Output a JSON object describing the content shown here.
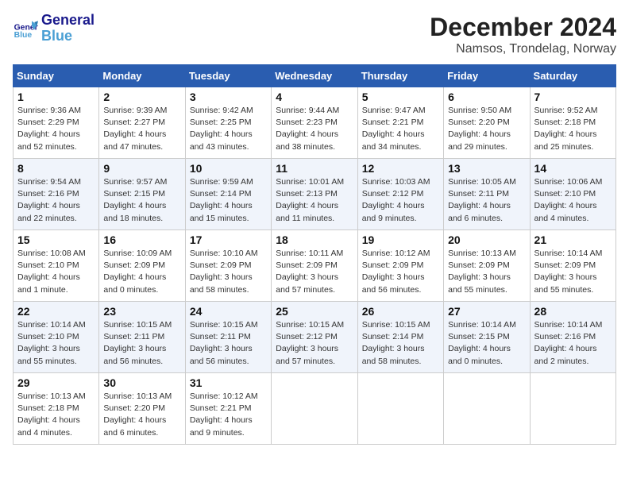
{
  "logo": {
    "general": "General",
    "blue": "Blue"
  },
  "title": "December 2024",
  "subtitle": "Namsos, Trondelag, Norway",
  "headers": [
    "Sunday",
    "Monday",
    "Tuesday",
    "Wednesday",
    "Thursday",
    "Friday",
    "Saturday"
  ],
  "weeks": [
    [
      {
        "day": "1",
        "sunrise": "Sunrise: 9:36 AM",
        "sunset": "Sunset: 2:29 PM",
        "daylight": "Daylight: 4 hours and 52 minutes."
      },
      {
        "day": "2",
        "sunrise": "Sunrise: 9:39 AM",
        "sunset": "Sunset: 2:27 PM",
        "daylight": "Daylight: 4 hours and 47 minutes."
      },
      {
        "day": "3",
        "sunrise": "Sunrise: 9:42 AM",
        "sunset": "Sunset: 2:25 PM",
        "daylight": "Daylight: 4 hours and 43 minutes."
      },
      {
        "day": "4",
        "sunrise": "Sunrise: 9:44 AM",
        "sunset": "Sunset: 2:23 PM",
        "daylight": "Daylight: 4 hours and 38 minutes."
      },
      {
        "day": "5",
        "sunrise": "Sunrise: 9:47 AM",
        "sunset": "Sunset: 2:21 PM",
        "daylight": "Daylight: 4 hours and 34 minutes."
      },
      {
        "day": "6",
        "sunrise": "Sunrise: 9:50 AM",
        "sunset": "Sunset: 2:20 PM",
        "daylight": "Daylight: 4 hours and 29 minutes."
      },
      {
        "day": "7",
        "sunrise": "Sunrise: 9:52 AM",
        "sunset": "Sunset: 2:18 PM",
        "daylight": "Daylight: 4 hours and 25 minutes."
      }
    ],
    [
      {
        "day": "8",
        "sunrise": "Sunrise: 9:54 AM",
        "sunset": "Sunset: 2:16 PM",
        "daylight": "Daylight: 4 hours and 22 minutes."
      },
      {
        "day": "9",
        "sunrise": "Sunrise: 9:57 AM",
        "sunset": "Sunset: 2:15 PM",
        "daylight": "Daylight: 4 hours and 18 minutes."
      },
      {
        "day": "10",
        "sunrise": "Sunrise: 9:59 AM",
        "sunset": "Sunset: 2:14 PM",
        "daylight": "Daylight: 4 hours and 15 minutes."
      },
      {
        "day": "11",
        "sunrise": "Sunrise: 10:01 AM",
        "sunset": "Sunset: 2:13 PM",
        "daylight": "Daylight: 4 hours and 11 minutes."
      },
      {
        "day": "12",
        "sunrise": "Sunrise: 10:03 AM",
        "sunset": "Sunset: 2:12 PM",
        "daylight": "Daylight: 4 hours and 9 minutes."
      },
      {
        "day": "13",
        "sunrise": "Sunrise: 10:05 AM",
        "sunset": "Sunset: 2:11 PM",
        "daylight": "Daylight: 4 hours and 6 minutes."
      },
      {
        "day": "14",
        "sunrise": "Sunrise: 10:06 AM",
        "sunset": "Sunset: 2:10 PM",
        "daylight": "Daylight: 4 hours and 4 minutes."
      }
    ],
    [
      {
        "day": "15",
        "sunrise": "Sunrise: 10:08 AM",
        "sunset": "Sunset: 2:10 PM",
        "daylight": "Daylight: 4 hours and 1 minute."
      },
      {
        "day": "16",
        "sunrise": "Sunrise: 10:09 AM",
        "sunset": "Sunset: 2:09 PM",
        "daylight": "Daylight: 4 hours and 0 minutes."
      },
      {
        "day": "17",
        "sunrise": "Sunrise: 10:10 AM",
        "sunset": "Sunset: 2:09 PM",
        "daylight": "Daylight: 3 hours and 58 minutes."
      },
      {
        "day": "18",
        "sunrise": "Sunrise: 10:11 AM",
        "sunset": "Sunset: 2:09 PM",
        "daylight": "Daylight: 3 hours and 57 minutes."
      },
      {
        "day": "19",
        "sunrise": "Sunrise: 10:12 AM",
        "sunset": "Sunset: 2:09 PM",
        "daylight": "Daylight: 3 hours and 56 minutes."
      },
      {
        "day": "20",
        "sunrise": "Sunrise: 10:13 AM",
        "sunset": "Sunset: 2:09 PM",
        "daylight": "Daylight: 3 hours and 55 minutes."
      },
      {
        "day": "21",
        "sunrise": "Sunrise: 10:14 AM",
        "sunset": "Sunset: 2:09 PM",
        "daylight": "Daylight: 3 hours and 55 minutes."
      }
    ],
    [
      {
        "day": "22",
        "sunrise": "Sunrise: 10:14 AM",
        "sunset": "Sunset: 2:10 PM",
        "daylight": "Daylight: 3 hours and 55 minutes."
      },
      {
        "day": "23",
        "sunrise": "Sunrise: 10:15 AM",
        "sunset": "Sunset: 2:11 PM",
        "daylight": "Daylight: 3 hours and 56 minutes."
      },
      {
        "day": "24",
        "sunrise": "Sunrise: 10:15 AM",
        "sunset": "Sunset: 2:11 PM",
        "daylight": "Daylight: 3 hours and 56 minutes."
      },
      {
        "day": "25",
        "sunrise": "Sunrise: 10:15 AM",
        "sunset": "Sunset: 2:12 PM",
        "daylight": "Daylight: 3 hours and 57 minutes."
      },
      {
        "day": "26",
        "sunrise": "Sunrise: 10:15 AM",
        "sunset": "Sunset: 2:14 PM",
        "daylight": "Daylight: 3 hours and 58 minutes."
      },
      {
        "day": "27",
        "sunrise": "Sunrise: 10:14 AM",
        "sunset": "Sunset: 2:15 PM",
        "daylight": "Daylight: 4 hours and 0 minutes."
      },
      {
        "day": "28",
        "sunrise": "Sunrise: 10:14 AM",
        "sunset": "Sunset: 2:16 PM",
        "daylight": "Daylight: 4 hours and 2 minutes."
      }
    ],
    [
      {
        "day": "29",
        "sunrise": "Sunrise: 10:13 AM",
        "sunset": "Sunset: 2:18 PM",
        "daylight": "Daylight: 4 hours and 4 minutes."
      },
      {
        "day": "30",
        "sunrise": "Sunrise: 10:13 AM",
        "sunset": "Sunset: 2:20 PM",
        "daylight": "Daylight: 4 hours and 6 minutes."
      },
      {
        "day": "31",
        "sunrise": "Sunrise: 10:12 AM",
        "sunset": "Sunset: 2:21 PM",
        "daylight": "Daylight: 4 hours and 9 minutes."
      },
      null,
      null,
      null,
      null
    ]
  ]
}
